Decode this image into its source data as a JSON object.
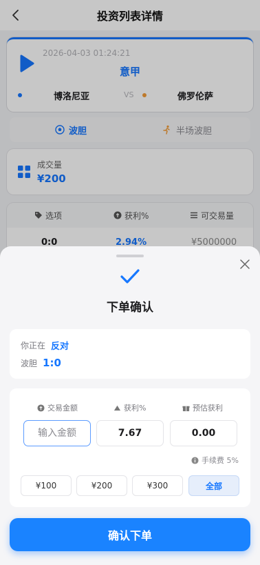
{
  "header": {
    "title": "投资列表详情"
  },
  "match": {
    "datetime": "2026-04-03 01:24:21",
    "league": "意甲",
    "home_team": "博洛尼亚",
    "vs": "VS",
    "away_team": "佛罗伦萨"
  },
  "tabs": [
    {
      "label": "波胆",
      "icon": "soccer-ball-icon",
      "active": true
    },
    {
      "label": "半场波胆",
      "icon": "runner-icon",
      "active": false
    }
  ],
  "volume": {
    "label": "成交量",
    "value": "¥200"
  },
  "table": {
    "headers": [
      {
        "label": "选项",
        "icon": "tag-icon"
      },
      {
        "label": "获利%",
        "icon": "coin-icon"
      },
      {
        "label": "可交易量",
        "icon": "list-icon"
      }
    ],
    "rows": [
      {
        "option": "0:0",
        "profit": "2.94%",
        "volume": "¥5000000"
      }
    ]
  },
  "sheet": {
    "title": "下单确认",
    "status_icon": "check-icon",
    "position_label": "你正在",
    "position_value": "反对",
    "score_label": "波胆",
    "score_value": "1:0",
    "amount_label": "交易金额",
    "profit_label": "获利%",
    "expected_label": "预估获利",
    "amount_placeholder": "输入金额",
    "profit_value": "7.67",
    "expected_value": "0.00",
    "fee_label": "手续费 5%",
    "quick_amounts": [
      "¥100",
      "¥200",
      "¥300",
      "全部"
    ],
    "confirm_label": "确认下单"
  },
  "colors": {
    "accent": "#1677ff",
    "away_dot": "#f29c38",
    "confirm": "#1a83ff"
  }
}
